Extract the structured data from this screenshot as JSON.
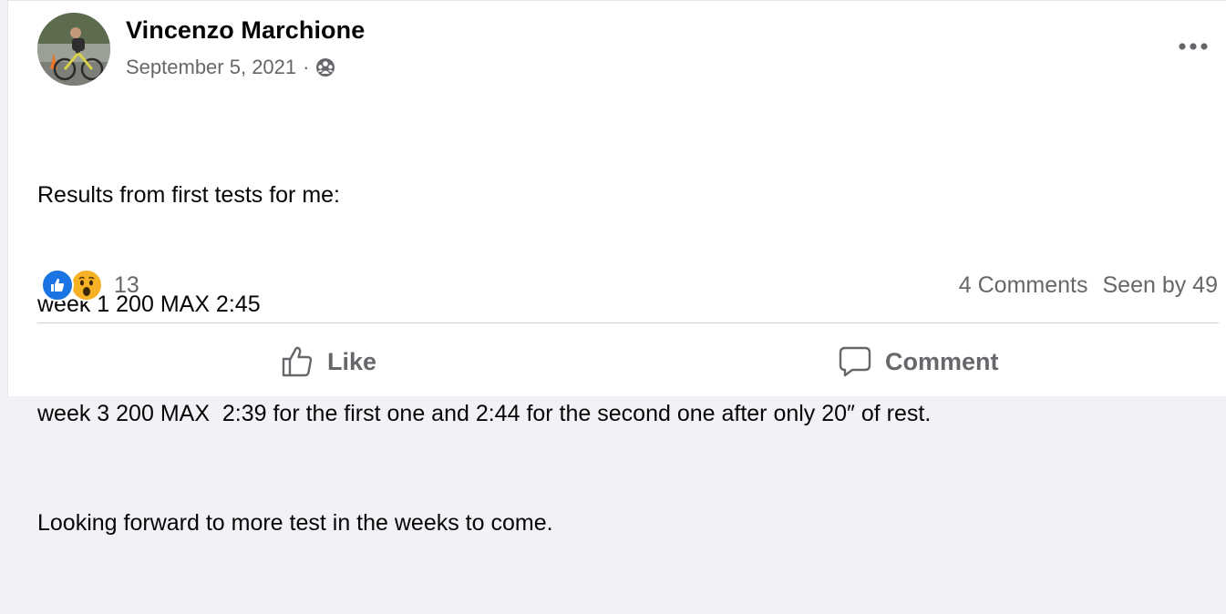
{
  "post": {
    "author": "Vincenzo Marchione",
    "date": "September 5, 2021",
    "separator": "·",
    "audience_icon": "group-audience-icon",
    "more_icon": "more-options-icon",
    "text_lines": [
      "Results from first tests for me:",
      "week 1 200 MAX 2:45",
      "week 3 200 MAX  2:39 for the first one and 2:44 for the second one after only 20″ of rest.",
      "Looking forward to more test in the weeks to come."
    ]
  },
  "reactions": {
    "types": [
      "like",
      "wow"
    ],
    "count": "13",
    "colors": {
      "like": "#1b74e4",
      "wow": "#f7b125"
    }
  },
  "stats": {
    "comments": "4 Comments",
    "seen_by": "Seen by 49"
  },
  "actions": {
    "like_label": "Like",
    "comment_label": "Comment"
  },
  "colors": {
    "text_primary": "#050505",
    "text_secondary": "#65676b",
    "divider": "#ced0d4",
    "background": "#ffffff"
  }
}
